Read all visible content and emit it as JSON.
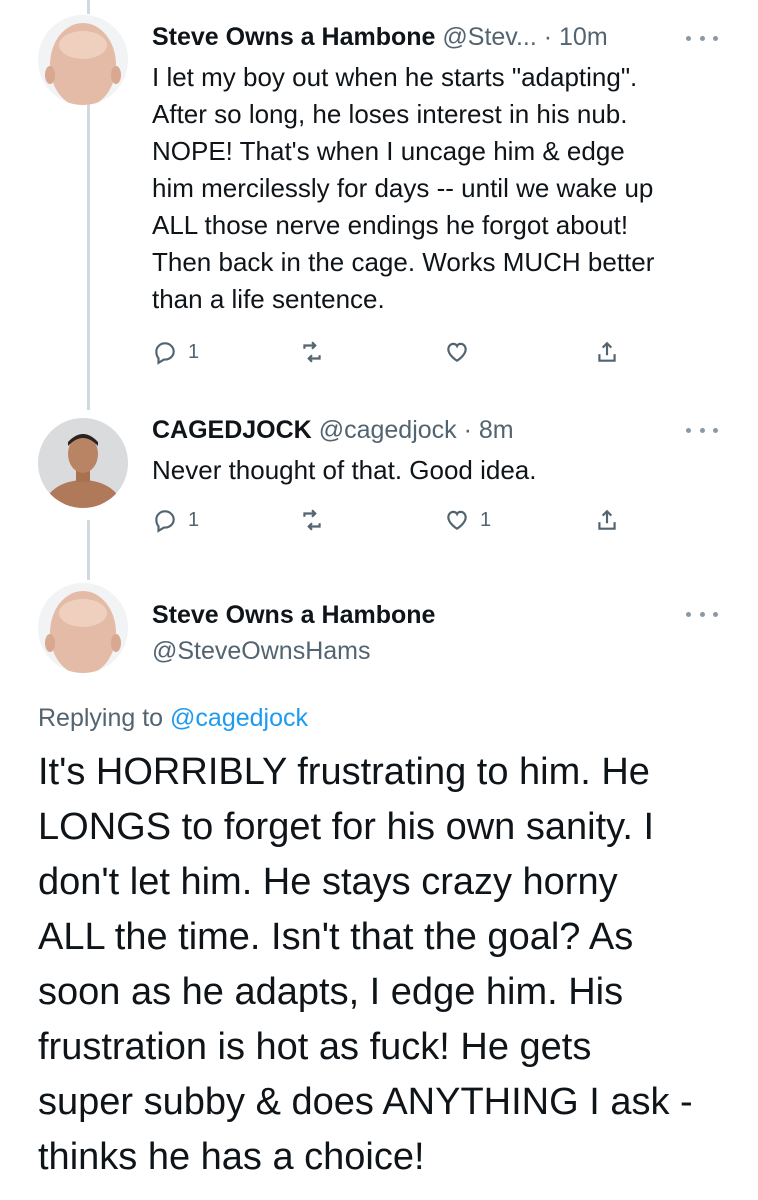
{
  "tweets": [
    {
      "name": "Steve Owns a Hambone",
      "handle": "@Stev...",
      "dot": "·",
      "time": "10m",
      "avatar_icon": "bald-head-avatar",
      "text": "I let my boy out when he starts \"adapting\".\nAfter so long, he loses interest in his nub.\nNOPE! That's when I uncage him & edge\nhim mercilessly for days -- until we wake up\nALL those nerve endings he forgot about!\nThen back in the cage. Works MUCH better\nthan a life sentence.",
      "reply_count": "1",
      "retweet_count": "",
      "like_count": ""
    },
    {
      "name": "CAGEDJOCK",
      "handle": "@cagedjock",
      "dot": "·",
      "time": "8m",
      "avatar_icon": "shirtless-man-avatar",
      "text": "Never thought of that. Good idea.",
      "reply_count": "1",
      "retweet_count": "",
      "like_count": "1"
    }
  ],
  "main_tweet": {
    "name": "Steve Owns a Hambone",
    "handle": "@SteveOwnsHams",
    "avatar_icon": "bald-head-avatar",
    "replying_prefix": "Replying to",
    "replying_to": "@cagedjock",
    "text": "It's HORRIBLY frustrating to him. He\nLONGS to forget for his own sanity. I\ndon't let him. He stays crazy horny\nALL the time. Isn't that the goal? As\nsoon as he adapts, I edge him. His\nfrustration is hot as fuck! He gets\nsuper subby & does ANYTHING I ask -\nthinks he has a choice!"
  },
  "colors": {
    "text": "#0f1419",
    "secondary": "#536471",
    "link": "#1d9bf0",
    "thread_line": "#cfd9de"
  }
}
